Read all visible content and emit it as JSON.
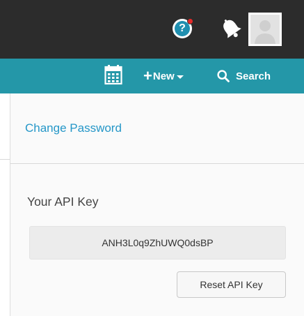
{
  "header": {
    "help_icon": "help-question-icon",
    "help_glyph": "?",
    "notification_icon": "bell-icon",
    "avatar_icon": "user-silhouette-icon",
    "colors": {
      "background": "#2c2c2c",
      "help_blue": "#1f8fb0",
      "alert_dot": "#e52b2b"
    }
  },
  "toolbar": {
    "calendar_icon": "calendar-icon",
    "new_plus": "+",
    "new_label": "New",
    "search_label": "Search",
    "colors": {
      "background": "#2497a8"
    }
  },
  "account": {
    "change_password_label": "Change Password",
    "api_key_title": "Your API Key",
    "api_key_value": "ANH3L0q9ZhUWQ0dsBP",
    "reset_api_key_label": "Reset API Key",
    "colors": {
      "link": "#2597c8"
    }
  }
}
